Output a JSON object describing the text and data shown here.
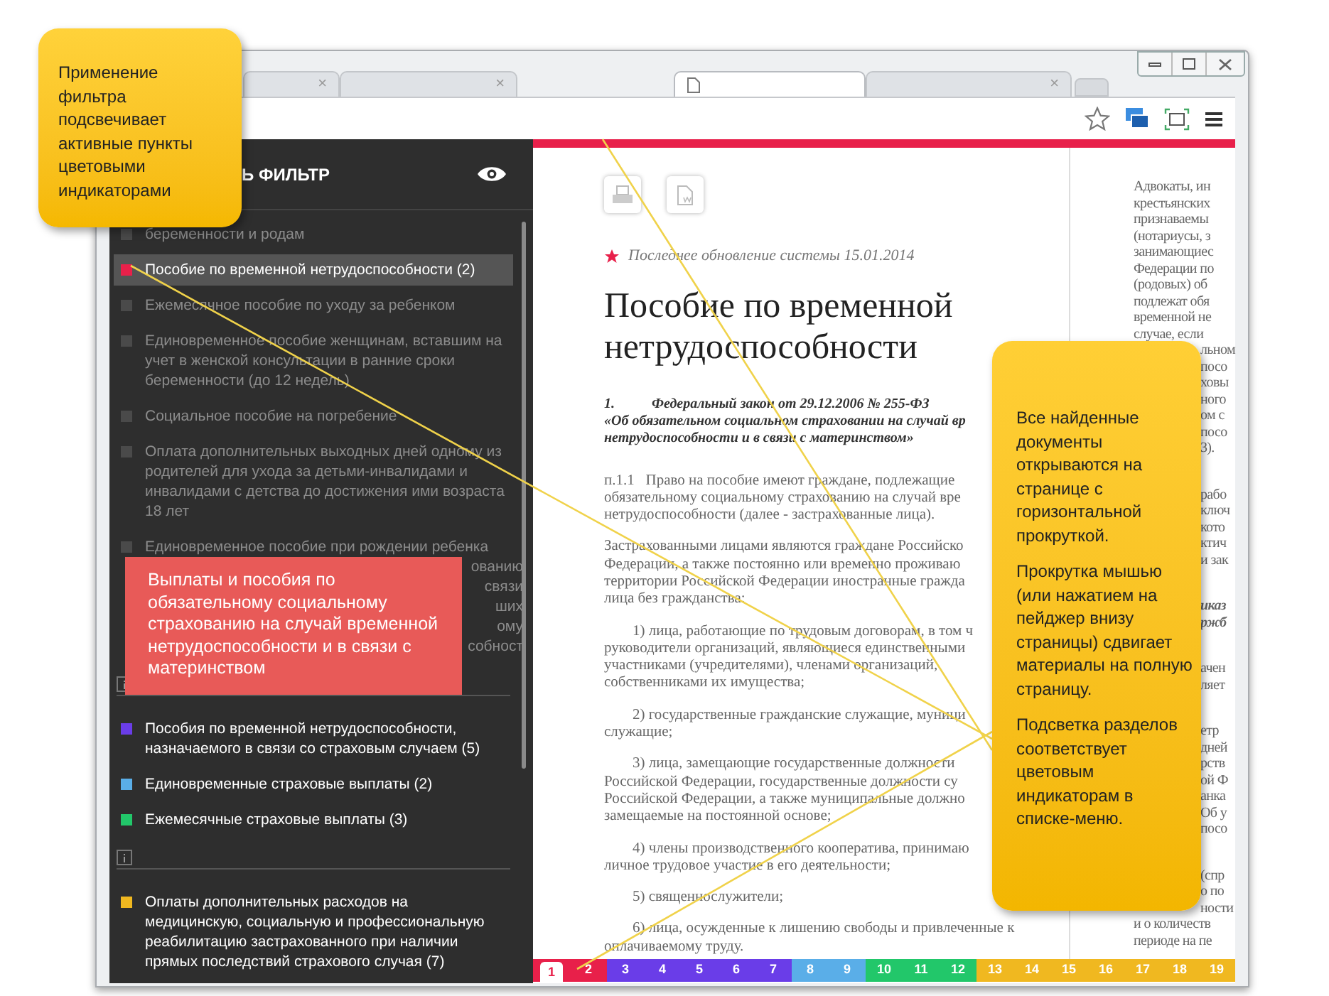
{
  "callouts": [
    {
      "kind": "yellow",
      "text": "Применение фильтра подсвечивает активные пункты цветовыми индикаторами"
    },
    {
      "kind": "red",
      "text": "Выплаты и пособия по обязательному социальному страхованию на случай временной нетрудоспособности и в связи с материнством"
    },
    {
      "kind": "yellow_tall",
      "paragraphs": [
        "Все найденные документы открываются на странице с горизонтальной прокруткой.",
        "Прокрутка мышью (или нажатием на пейджер внизу страницы) сдвигает материалы на полную  страницу.",
        "Подсветка разделов соответствует цветовым индикаторам в списке-меню."
      ]
    }
  ],
  "browser": {
    "tabs": [
      {
        "close": "×",
        "selected": false
      },
      {
        "close": "×",
        "selected": false
      },
      {
        "selected": true
      },
      {
        "close": "×",
        "selected": false
      }
    ]
  },
  "sidebar": {
    "title": "Ь ФИЛЬТР",
    "groups": [
      {
        "items": [
          {
            "text": "беременности и родам",
            "color": "#4a4a4a",
            "active": false,
            "selected": false
          },
          {
            "text": "Пособие по временной нетрудоспособности (2)",
            "color": "#e8204a",
            "active": true,
            "selected": true
          },
          {
            "text": "Ежемесячное пособие по уходу за ребенком",
            "color": "#4a4a4a",
            "active": false,
            "selected": false
          },
          {
            "text": "Единовременное пособие женщинам, вставшим на учет в женской консультации в ранние сроки беременности (до 12 недель)",
            "color": "#4a4a4a",
            "active": false,
            "selected": false
          },
          {
            "text": "Социальное пособие на погребение",
            "color": "#4a4a4a",
            "active": false,
            "selected": false
          },
          {
            "text": "Оплата дополнительных выходных дней одному из родителей для ухода за детьми-инвалидами и инвалидами с детства до достижения ими возраста 18 лет",
            "color": "#4a4a4a",
            "active": false,
            "selected": false
          },
          {
            "text": "Единовременное пособие при рождении ребенка",
            "color": "#4a4a4a",
            "active": false,
            "selected": false,
            "fragments": [
              "ованию",
              "связи",
              "ших",
              "ому",
              "собност"
            ]
          }
        ]
      },
      {
        "items": [
          {
            "text": "Пособия по временной нетрудоспособности, назначаемого в связи со страховым случаем (5)",
            "color": "#6a3de8",
            "active": true,
            "selected": false
          },
          {
            "text": "Единовременные страховые выплаты (2)",
            "color": "#5aaee8",
            "active": true,
            "selected": false
          },
          {
            "text": "Ежемесячные страховые выплаты (3)",
            "color": "#22c76a",
            "active": true,
            "selected": false
          }
        ]
      },
      {
        "items": [
          {
            "text": "Оплаты дополнительных расходов на медицинскую, социальную и профессиональную реабилитацию застрахованного при наличии прямых последствий страхового случая (7)",
            "color": "#f0b820",
            "active": true,
            "selected": false
          }
        ]
      }
    ]
  },
  "document": {
    "update": "Последнее обновление системы 15.01.2014",
    "title": "Пособие по временной нетрудоспособности",
    "law": {
      "number": "1.",
      "name": "Федеральный закон от 29.12.2006 № 255-ФЗ",
      "lines": [
        "«Об обязательном социальном страховании на случай вр",
        "нетрудоспособности и в связи с материнством»"
      ]
    },
    "paragraphs": [
      [
        "п.1.1   Право на пособие имеют граждане, подлежащие",
        "обязательному социальному страхованию на случай вре",
        "нетрудоспособности (далее - застрахованные лица)."
      ],
      [
        "Застрахованными лицами являются граждане Российско",
        "Федерации, а также постоянно или временно проживаю",
        "территории Российской Федерации иностранные гражда",
        "лица без гражданства:"
      ],
      [
        "1) лица, работающие по трудовым договорам, в том ч",
        "руководители организаций, являющиеся единственными",
        "участниками (учредителями), членами организаций,",
        "собственниками их имущества;"
      ],
      [
        "2) государственные гражданские служащие, муници",
        "служащие;"
      ],
      [
        "3) лица, замещающие государственные должности",
        "Российской Федерации, государственные должности су",
        "Российской Федерации, а также муниципальные должно",
        "замещаемые на постоянной основе;"
      ],
      [
        "4) члены производственного кооператива, принимаю",
        "личное трудовое участие в его деятельности;"
      ],
      [
        "5) священнослужители;"
      ],
      [
        "6) лица, осужденные к лишению свободы и привлеченные к",
        "оплачиваемому труду."
      ]
    ]
  },
  "next_page": {
    "paragraphs": [
      [
        {
          "kind": "full",
          "text": "Адвокаты, ин"
        },
        {
          "kind": "full",
          "text": "крестьянских"
        },
        {
          "kind": "full",
          "text": "признаваемы"
        },
        {
          "kind": "full",
          "text": "(нотариусы, з"
        },
        {
          "kind": "full",
          "text": "занимающиес"
        },
        {
          "kind": "full",
          "text": "Федерации по"
        },
        {
          "kind": "full",
          "text": "(родовых) об"
        },
        {
          "kind": "full",
          "text": "подлежат обя"
        },
        {
          "kind": "full",
          "text": "временной не"
        },
        {
          "kind": "full",
          "text": "случае, если"
        },
        {
          "kind": "fragment",
          "text": "льном"
        },
        {
          "kind": "fragment",
          "text": "посо"
        },
        {
          "kind": "fragment",
          "text": "ховы"
        },
        {
          "kind": "fragment",
          "text": "ного"
        },
        {
          "kind": "fragment",
          "text": "ом с"
        },
        {
          "kind": "fragment",
          "text": "посо"
        },
        {
          "kind": "fragment",
          "text": "3)."
        }
      ],
      [
        {
          "kind": "fragment",
          "text": "рабо"
        },
        {
          "kind": "fragment",
          "text": "ключ"
        },
        {
          "kind": "fragment",
          "text": "кото"
        },
        {
          "kind": "fragment",
          "text": "ктич"
        },
        {
          "kind": "fragment",
          "text": "и зак"
        }
      ],
      [
        {
          "kind": "italic",
          "text": "иказ"
        },
        {
          "kind": "italic",
          "text": "ржб"
        }
      ],
      [
        {
          "kind": "fragment",
          "text": "ачен"
        },
        {
          "kind": "fragment",
          "text": "ляет"
        }
      ],
      [
        {
          "kind": "fragment",
          "text": "етр"
        },
        {
          "kind": "fragment",
          "text": "дней"
        },
        {
          "kind": "fragment",
          "text": "рств"
        },
        {
          "kind": "fragment",
          "text": "ой Ф"
        },
        {
          "kind": "fragment",
          "text": "анка"
        },
        {
          "kind": "fragment",
          "text": "Об у"
        },
        {
          "kind": "fragment",
          "text": "посо"
        }
      ],
      [
        {
          "kind": "fragment",
          "text": "(спр"
        },
        {
          "kind": "fragment",
          "text": "о по"
        },
        {
          "kind": "fragment",
          "text": "ности"
        },
        {
          "kind": "full",
          "text": "и о количеств"
        },
        {
          "kind": "full",
          "text": "периоде на пе"
        }
      ]
    ]
  },
  "pager": [
    {
      "label": "1",
      "color": "#e8204a",
      "selected": true
    },
    {
      "label": "2",
      "color": "#e8204a",
      "selected": false
    },
    {
      "label": "3",
      "color": "#6a3de8",
      "selected": false
    },
    {
      "label": "4",
      "color": "#6a3de8",
      "selected": false
    },
    {
      "label": "5",
      "color": "#6a3de8",
      "selected": false
    },
    {
      "label": "6",
      "color": "#6a3de8",
      "selected": false
    },
    {
      "label": "7",
      "color": "#6a3de8",
      "selected": false
    },
    {
      "label": "8",
      "color": "#5aaee8",
      "selected": false
    },
    {
      "label": "9",
      "color": "#5aaee8",
      "selected": false
    },
    {
      "label": "10",
      "color": "#22c76a",
      "selected": false
    },
    {
      "label": "11",
      "color": "#22c76a",
      "selected": false
    },
    {
      "label": "12",
      "color": "#22c76a",
      "selected": false
    },
    {
      "label": "13",
      "color": "#f0b820",
      "selected": false
    },
    {
      "label": "14",
      "color": "#f0b820",
      "selected": false
    },
    {
      "label": "15",
      "color": "#f0b820",
      "selected": false
    },
    {
      "label": "16",
      "color": "#f0b820",
      "selected": false
    },
    {
      "label": "17",
      "color": "#f0b820",
      "selected": false
    },
    {
      "label": "18",
      "color": "#f0b820",
      "selected": false
    },
    {
      "label": "19",
      "color": "#f0b820",
      "selected": false
    }
  ]
}
